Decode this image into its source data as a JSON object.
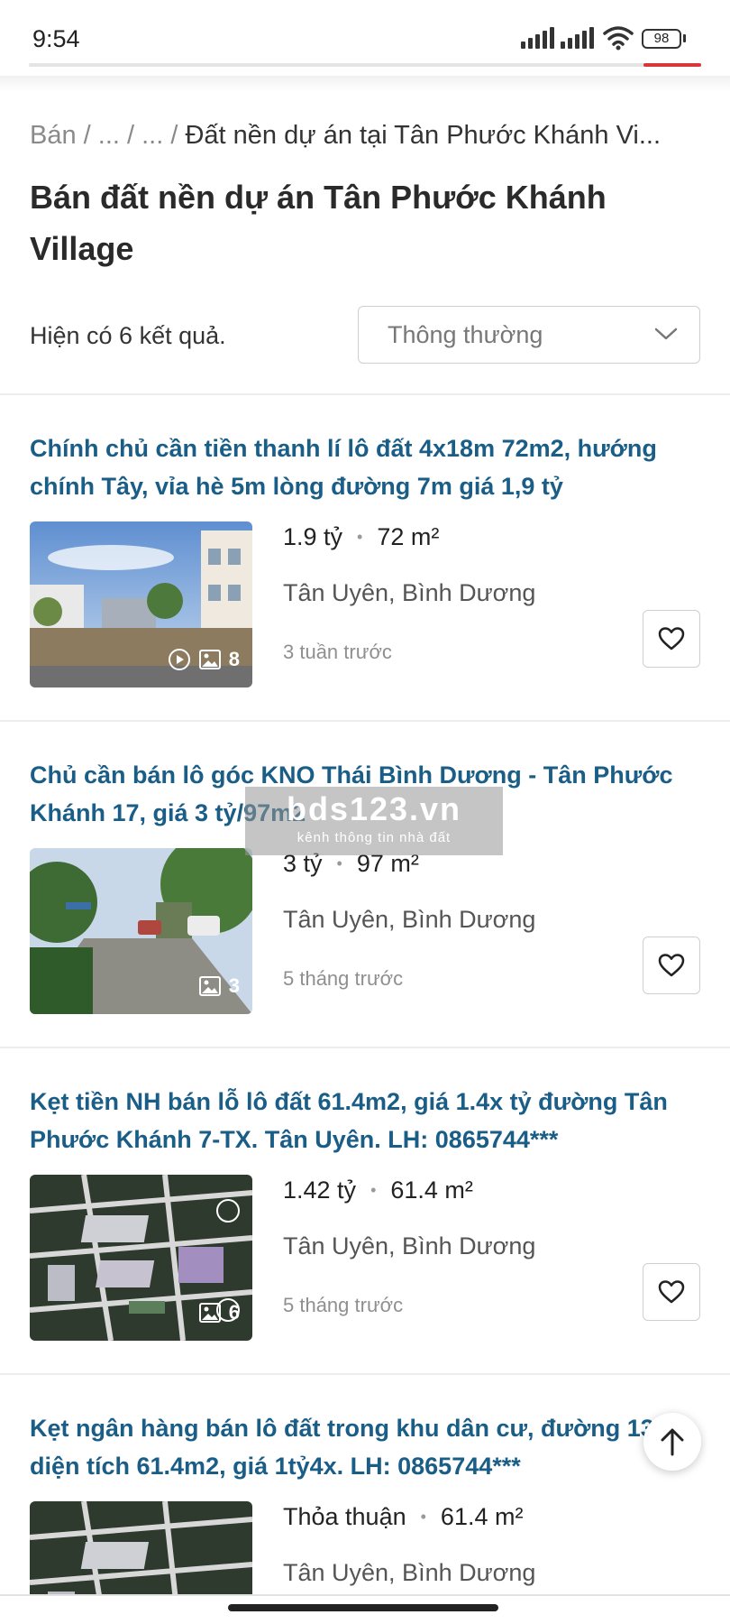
{
  "status_bar": {
    "time": "9:54",
    "battery": "98"
  },
  "breadcrumb": {
    "root": "Bán",
    "sep1": " / ",
    "mid1": "...",
    "sep2": " / ",
    "mid2": "...",
    "sep3": " / ",
    "current": "Đất nền dự án tại Tân Phước Khánh Vi..."
  },
  "page_title": "Bán đất nền dự án Tân Phước Khánh Village",
  "results": {
    "count_text": "Hiện có 6 kết quả.",
    "sort_value": "Thông thường"
  },
  "listings": [
    {
      "title": "Chính chủ cần tiền thanh lí lô đất 4x18m 72m2, hướng chính Tây, vỉa hè 5m lòng đường 7m giá 1,9 tỷ",
      "price": "1.9 tỷ",
      "area": "72 m²",
      "location": "Tân Uyên, Bình Dương",
      "posted": "3 tuần trước",
      "image_count": "8",
      "has_video": true,
      "thumb_icons": [
        "play-icon",
        "image-icon"
      ]
    },
    {
      "title": "Chủ cần bán lô góc KNO Thái Bình Dương - Tân Phước Khánh 17, giá 3 tỷ/97m2",
      "price": "3 tỷ",
      "area": "97 m²",
      "location": "Tân Uyên, Bình Dương",
      "posted": "5 tháng trước",
      "image_count": "3",
      "has_video": false,
      "thumb_icons": [
        "image-icon"
      ]
    },
    {
      "title": "Kẹt tiền NH bán lỗ lô đất 61.4m2, giá 1.4x tỷ đường Tân Phước Khánh 7-TX. Tân Uyên. LH: 0865744***",
      "price": "1.42 tỷ",
      "area": "61.4 m²",
      "location": "Tân Uyên, Bình Dương",
      "posted": "5 tháng trước",
      "image_count": "6",
      "has_video": false,
      "thumb_icons": [
        "image-icon"
      ]
    },
    {
      "title": "Kẹt ngân hàng bán lô đất trong khu dân cư, đường 13m, diện tích 61.4m2, giá 1tỷ4x. LH: 0865744***",
      "price": "Thỏa thuận",
      "area": "61.4 m²",
      "location": "Tân Uyên, Bình Dương"
    }
  ],
  "watermark": {
    "main": "bds123.vn",
    "sub": "kênh thông tin nhà đất"
  },
  "icons": {
    "favorite": "heart-icon",
    "sort_toggle": "chevron-down-icon",
    "scroll_top": "arrow-up-icon"
  },
  "colors": {
    "title_link": "#1a5d86",
    "accent_red": "#d9363e",
    "muted": "#8f8f8f"
  }
}
